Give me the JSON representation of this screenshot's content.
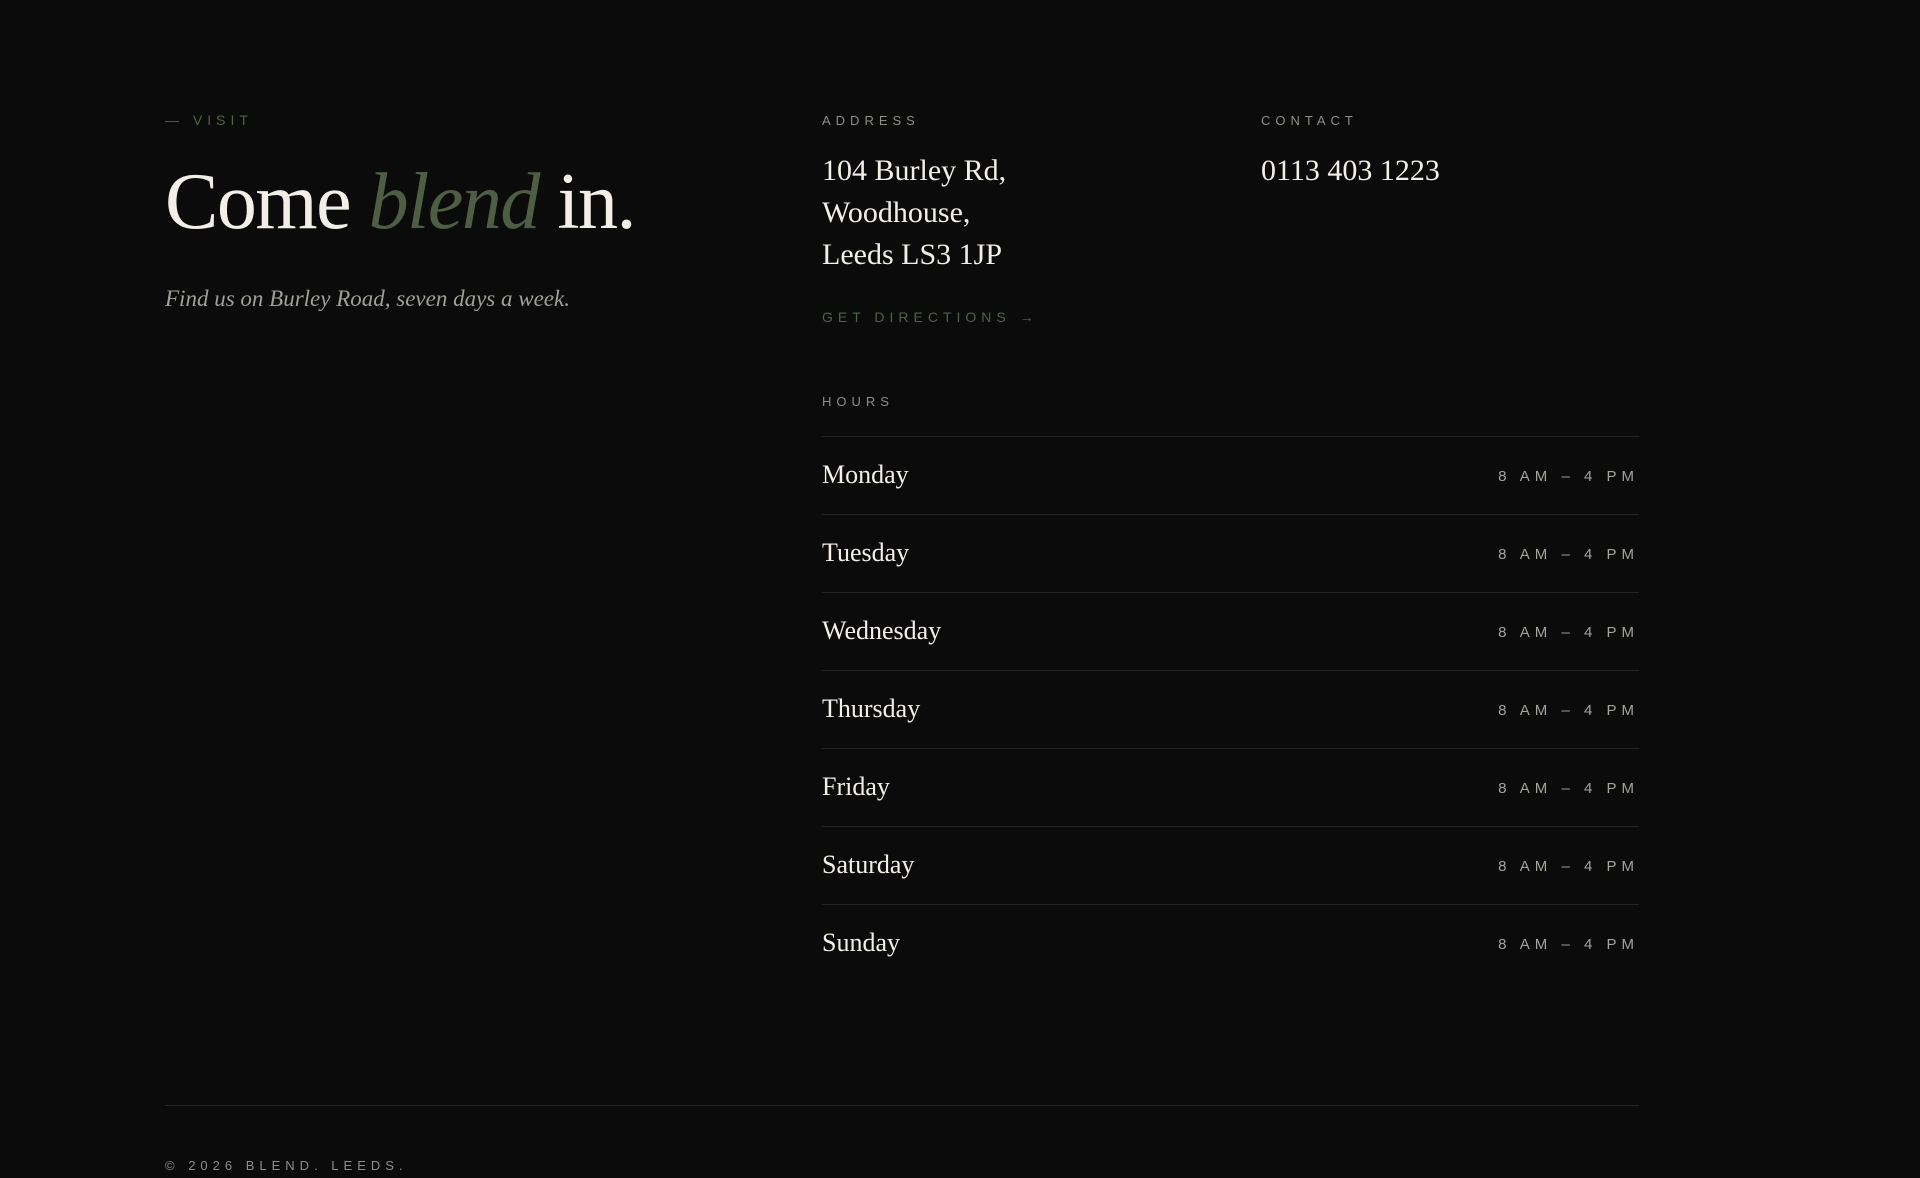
{
  "visit": {
    "eyebrow": "— VISIT",
    "headline_before": "Come ",
    "headline_accent": "blend",
    "headline_after": " in.",
    "subline": "Find us on Burley Road, seven days a week."
  },
  "address": {
    "label": "ADDRESS",
    "lines": [
      "104 Burley Rd,",
      "Woodhouse,",
      "Leeds LS3 1JP"
    ],
    "directions_label": "GET DIRECTIONS →"
  },
  "contact": {
    "label": "CONTACT",
    "phone": "0113 403 1223"
  },
  "hours": {
    "label": "HOURS",
    "rows": [
      {
        "day": "Monday",
        "time": "8 AM – 4 PM"
      },
      {
        "day": "Tuesday",
        "time": "8 AM – 4 PM"
      },
      {
        "day": "Wednesday",
        "time": "8 AM – 4 PM"
      },
      {
        "day": "Thursday",
        "time": "8 AM – 4 PM"
      },
      {
        "day": "Friday",
        "time": "8 AM – 4 PM"
      },
      {
        "day": "Saturday",
        "time": "8 AM – 4 PM"
      },
      {
        "day": "Sunday",
        "time": "8 AM – 4 PM"
      }
    ]
  },
  "footer": {
    "copyright": "© 2026 BLEND. LEEDS."
  },
  "colors": {
    "background": "#0b0b0b",
    "text": "#f1efe7",
    "accent_green": "#4d5e44",
    "muted": "#8d8c86",
    "divider": "#232323"
  }
}
